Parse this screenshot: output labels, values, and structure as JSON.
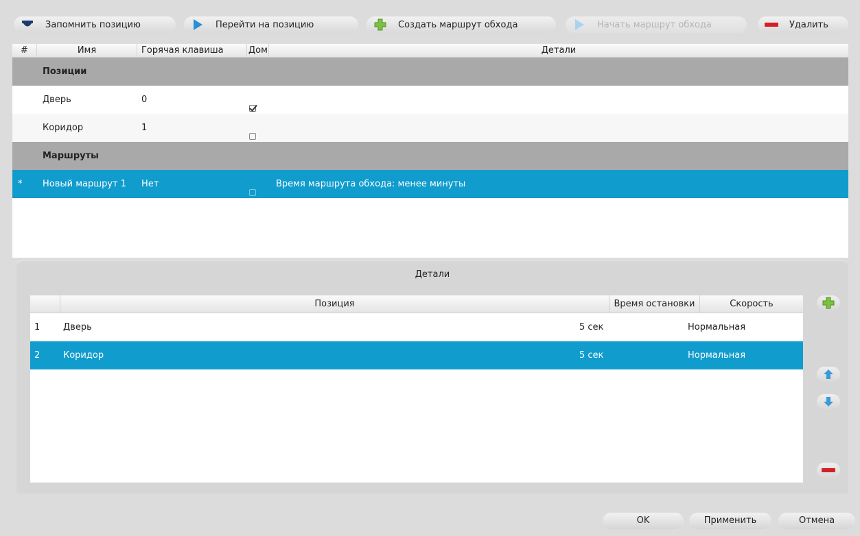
{
  "toolbar": {
    "save_position": "Запомнить позицию",
    "goto_position": "Перейти на позицию",
    "create_route": "Создать маршрут обхода",
    "start_route": "Начать маршрут обхода",
    "delete": "Удалить"
  },
  "main_table": {
    "columns": [
      "#",
      "Имя",
      "Горячая клавиша",
      "Дом",
      "Детали"
    ],
    "groups": [
      {
        "title": "Позиции",
        "rows": [
          {
            "num": "",
            "name": "Дверь",
            "hotkey": "0",
            "home": true,
            "details": ""
          },
          {
            "num": "",
            "name": "Коридор",
            "hotkey": "1",
            "home": false,
            "details": ""
          }
        ]
      },
      {
        "title": "Маршруты",
        "rows": [
          {
            "num": "*",
            "name": "Новый маршрут 1",
            "hotkey": "Нет",
            "home": false,
            "details": "Время маршрута обхода: менее минуты",
            "selected": true
          }
        ]
      }
    ]
  },
  "details": {
    "title": "Детали",
    "columns": [
      "",
      "Позиция",
      "Время остановки",
      "Скорость"
    ],
    "rows": [
      {
        "num": "1",
        "position": "Дверь",
        "stop_time": "5 сек",
        "speed": "Нормальная",
        "selected": false
      },
      {
        "num": "2",
        "position": "Коридор",
        "stop_time": "5 сек",
        "speed": "Нормальная",
        "selected": true
      }
    ]
  },
  "footer": {
    "ok": "OK",
    "apply": "Применить",
    "cancel": "Отмена"
  },
  "colors": {
    "selection": "#109ccd",
    "group_header": "#a9a9a9",
    "add_green": "#7cc242",
    "delete_red": "#d41f26",
    "arrow_blue": "#3a9ad9"
  }
}
